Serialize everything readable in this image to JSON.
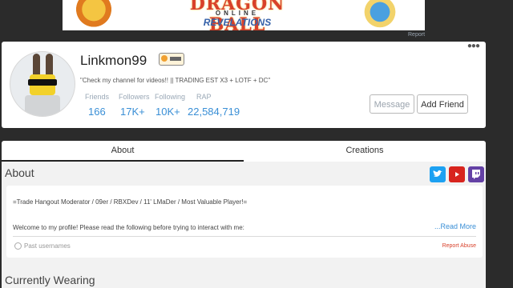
{
  "banner": {
    "logo_main": "DRAGON BALL",
    "logo_sub": "ONLINE",
    "logo_sub2": "REVELATIONS",
    "report_label": "Report"
  },
  "profile": {
    "username": "Linkmon99",
    "status": "\"Check my channel for videos!! || TRADING EST X3 + LOTF + DC\"",
    "stats": [
      {
        "label": "Friends",
        "value": "166"
      },
      {
        "label": "Followers",
        "value": "17K+"
      },
      {
        "label": "Following",
        "value": "10K+"
      },
      {
        "label": "RAP",
        "value": "22,584,719"
      }
    ],
    "message_button": "Message",
    "add_friend_button": "Add Friend",
    "more_icon": "more-dots-icon"
  },
  "tabs": {
    "about": "About",
    "creations": "Creations"
  },
  "about": {
    "title": "About",
    "line1": "=Trade Hangout Moderator / 09er / RBXDev / 11' LMaDer / Most Valuable Player!=",
    "line2": "Welcome to my profile! Please read the following before trying to interact with me:",
    "read_more": "...Read More",
    "past_usernames": "Past usernames",
    "report_abuse": "Report Abuse",
    "social_icons": [
      "twitter-icon",
      "youtube-icon",
      "twitch-icon"
    ]
  },
  "wearing": {
    "title": "Currently Wearing"
  },
  "colors": {
    "link": "#3a8fd6",
    "twitter": "#1da1f2",
    "youtube": "#d8241e",
    "twitch": "#6441a5",
    "report": "#d8412b"
  }
}
